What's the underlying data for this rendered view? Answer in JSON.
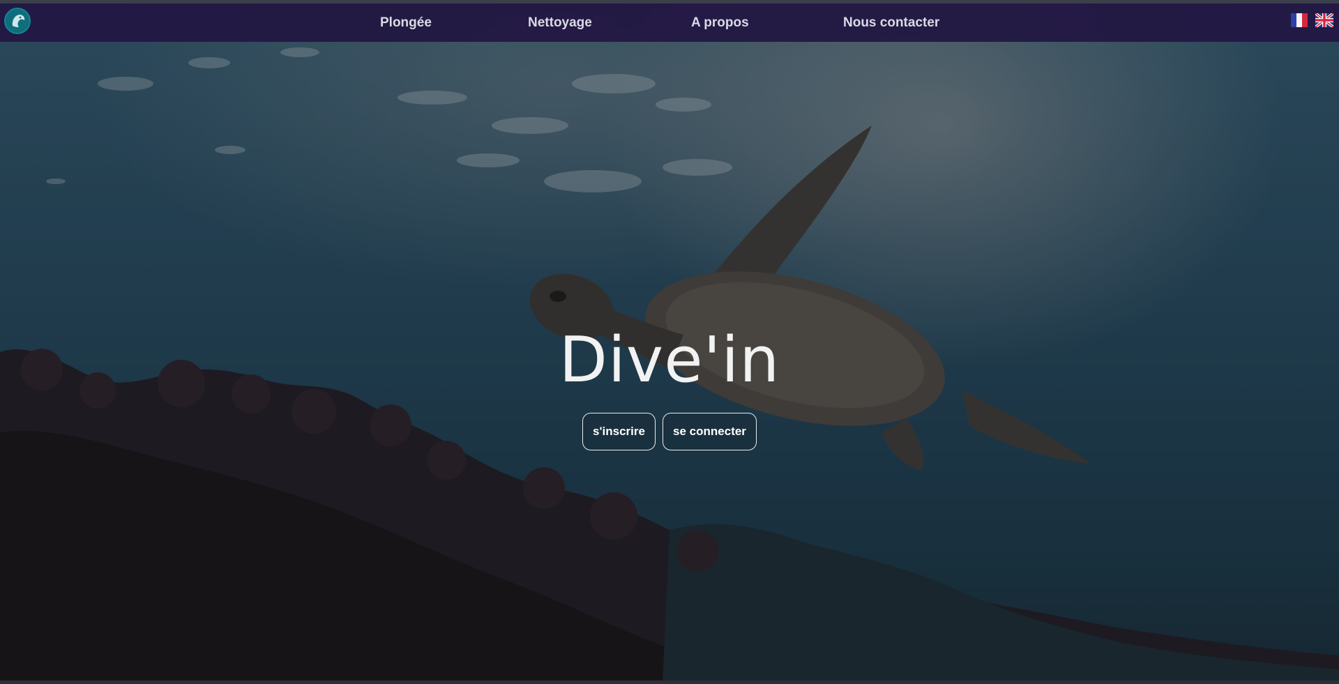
{
  "navbar": {
    "logo_icon": "dolphin-logo-icon",
    "links": [
      {
        "label": "Plongée"
      },
      {
        "label": "Nettoyage"
      },
      {
        "label": "A propos"
      },
      {
        "label": "Nous contacter"
      }
    ],
    "languages": [
      {
        "icon": "flag-fr-icon"
      },
      {
        "icon": "flag-uk-icon"
      }
    ]
  },
  "hero": {
    "title": "Dive'in",
    "buttons": {
      "signup_label": "s'inscrire",
      "login_label": "se connecter"
    }
  },
  "colors": {
    "navbar": "#221642",
    "logo": "#0f6e7c",
    "text": "#ffffff"
  }
}
